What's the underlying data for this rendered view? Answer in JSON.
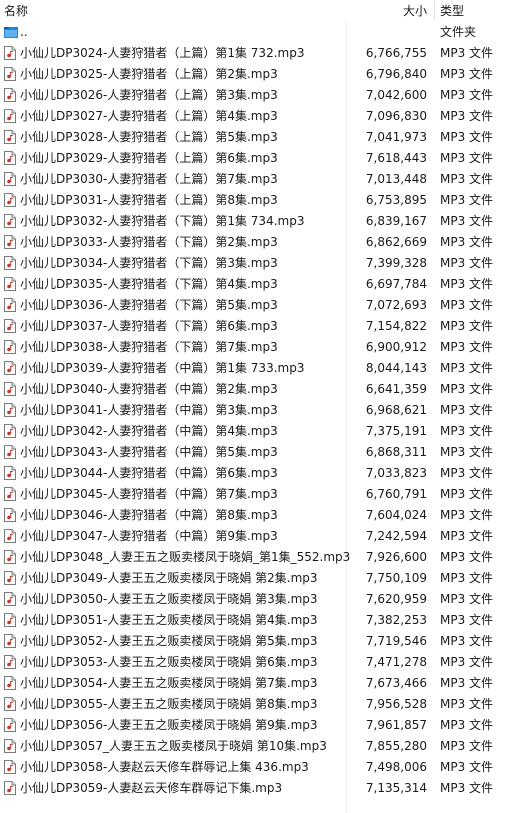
{
  "header": {
    "name_label": "名称",
    "size_label": "大小",
    "type_label": "类型",
    "sort_indicator": "^"
  },
  "parent": {
    "name": "..",
    "type": "文件夹"
  },
  "files": [
    {
      "name": "小仙儿DP3024-人妻狩猎者（上篇）第1集 732.mp3",
      "size": "6,766,755",
      "type": "MP3 文件"
    },
    {
      "name": "小仙儿DP3025-人妻狩猎者（上篇）第2集.mp3",
      "size": "6,796,840",
      "type": "MP3 文件"
    },
    {
      "name": "小仙儿DP3026-人妻狩猎者（上篇）第3集.mp3",
      "size": "7,042,600",
      "type": "MP3 文件"
    },
    {
      "name": "小仙儿DP3027-人妻狩猎者（上篇）第4集.mp3",
      "size": "7,096,830",
      "type": "MP3 文件"
    },
    {
      "name": "小仙儿DP3028-人妻狩猎者（上篇）第5集.mp3",
      "size": "7,041,973",
      "type": "MP3 文件"
    },
    {
      "name": "小仙儿DP3029-人妻狩猎者（上篇）第6集.mp3",
      "size": "7,618,443",
      "type": "MP3 文件"
    },
    {
      "name": "小仙儿DP3030-人妻狩猎者（上篇）第7集.mp3",
      "size": "7,013,448",
      "type": "MP3 文件"
    },
    {
      "name": "小仙儿DP3031-人妻狩猎者（上篇）第8集.mp3",
      "size": "6,753,895",
      "type": "MP3 文件"
    },
    {
      "name": "小仙儿DP3032-人妻狩猎者（下篇）第1集 734.mp3",
      "size": "6,839,167",
      "type": "MP3 文件"
    },
    {
      "name": "小仙儿DP3033-人妻狩猎者（下篇）第2集.mp3",
      "size": "6,862,669",
      "type": "MP3 文件"
    },
    {
      "name": "小仙儿DP3034-人妻狩猎者（下篇）第3集.mp3",
      "size": "7,399,328",
      "type": "MP3 文件"
    },
    {
      "name": "小仙儿DP3035-人妻狩猎者（下篇）第4集.mp3",
      "size": "6,697,784",
      "type": "MP3 文件"
    },
    {
      "name": "小仙儿DP3036-人妻狩猎者（下篇）第5集.mp3",
      "size": "7,072,693",
      "type": "MP3 文件"
    },
    {
      "name": "小仙儿DP3037-人妻狩猎者（下篇）第6集.mp3",
      "size": "7,154,822",
      "type": "MP3 文件"
    },
    {
      "name": "小仙儿DP3038-人妻狩猎者（下篇）第7集.mp3",
      "size": "6,900,912",
      "type": "MP3 文件"
    },
    {
      "name": "小仙儿DP3039-人妻狩猎者（中篇）第1集 733.mp3",
      "size": "8,044,143",
      "type": "MP3 文件"
    },
    {
      "name": "小仙儿DP3040-人妻狩猎者（中篇）第2集.mp3",
      "size": "6,641,359",
      "type": "MP3 文件"
    },
    {
      "name": "小仙儿DP3041-人妻狩猎者（中篇）第3集.mp3",
      "size": "6,968,621",
      "type": "MP3 文件"
    },
    {
      "name": "小仙儿DP3042-人妻狩猎者（中篇）第4集.mp3",
      "size": "7,375,191",
      "type": "MP3 文件"
    },
    {
      "name": "小仙儿DP3043-人妻狩猎者（中篇）第5集.mp3",
      "size": "6,868,311",
      "type": "MP3 文件"
    },
    {
      "name": "小仙儿DP3044-人妻狩猎者（中篇）第6集.mp3",
      "size": "7,033,823",
      "type": "MP3 文件"
    },
    {
      "name": "小仙儿DP3045-人妻狩猎者（中篇）第7集.mp3",
      "size": "6,760,791",
      "type": "MP3 文件"
    },
    {
      "name": "小仙儿DP3046-人妻狩猎者（中篇）第8集.mp3",
      "size": "7,604,024",
      "type": "MP3 文件"
    },
    {
      "name": "小仙儿DP3047-人妻狩猎者（中篇）第9集.mp3",
      "size": "7,242,594",
      "type": "MP3 文件"
    },
    {
      "name": "小仙儿DP3048_人妻王五之贩卖楼凤于晓娟_第1集_552.mp3",
      "size": "7,926,600",
      "type": "MP3 文件"
    },
    {
      "name": "小仙儿DP3049-人妻王五之贩卖楼凤于晓娟 第2集.mp3",
      "size": "7,750,109",
      "type": "MP3 文件"
    },
    {
      "name": "小仙儿DP3050-人妻王五之贩卖楼凤于晓娟 第3集.mp3",
      "size": "7,620,959",
      "type": "MP3 文件"
    },
    {
      "name": "小仙儿DP3051-人妻王五之贩卖楼凤于晓娟 第4集.mp3",
      "size": "7,382,253",
      "type": "MP3 文件"
    },
    {
      "name": "小仙儿DP3052-人妻王五之贩卖楼凤于晓娟 第5集.mp3",
      "size": "7,719,546",
      "type": "MP3 文件"
    },
    {
      "name": "小仙儿DP3053-人妻王五之贩卖楼凤于晓娟 第6集.mp3",
      "size": "7,471,278",
      "type": "MP3 文件"
    },
    {
      "name": "小仙儿DP3054-人妻王五之贩卖楼凤于晓娟 第7集.mp3",
      "size": "7,673,466",
      "type": "MP3 文件"
    },
    {
      "name": "小仙儿DP3055-人妻王五之贩卖楼凤于晓娟 第8集.mp3",
      "size": "7,956,528",
      "type": "MP3 文件"
    },
    {
      "name": "小仙儿DP3056-人妻王五之贩卖楼凤于晓娟 第9集.mp3",
      "size": "7,961,857",
      "type": "MP3 文件"
    },
    {
      "name": "小仙儿DP3057_人妻王五之贩卖楼凤于晓娟 第10集.mp3",
      "size": "7,855,280",
      "type": "MP3 文件"
    },
    {
      "name": "小仙儿DP3058-人妻赵云天修车群辱记上集 436.mp3",
      "size": "7,498,006",
      "type": "MP3 文件"
    },
    {
      "name": "小仙儿DP3059-人妻赵云天修车群辱记下集.mp3",
      "size": "7,135,314",
      "type": "MP3 文件"
    }
  ],
  "icons": {
    "file_icon": "audio-file-icon",
    "parent_icon": "folder-up-icon",
    "folder_color": "#1e88e5"
  }
}
